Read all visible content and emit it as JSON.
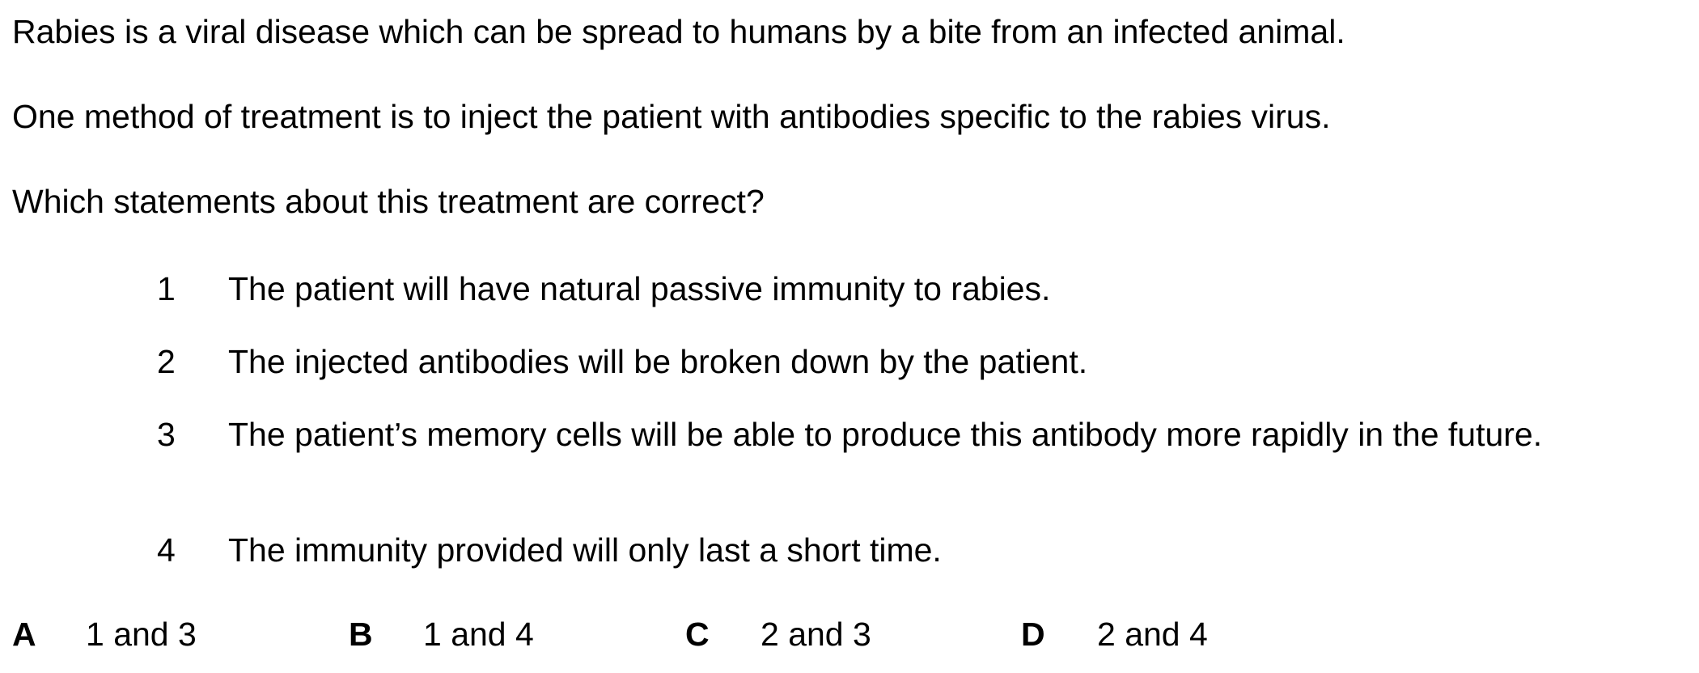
{
  "question": {
    "intro": "Rabies is a viral disease which can be spread to humans by a bite from an infected animal.",
    "treatment": "One method of treatment is to inject the patient with antibodies specific to the rabies virus.",
    "prompt": "Which statements about this treatment are correct?"
  },
  "statements": [
    {
      "number": "1",
      "text": "The patient will have natural passive immunity to rabies."
    },
    {
      "number": "2",
      "text": "The injected antibodies will be broken down by the patient."
    },
    {
      "number": "3",
      "text": "The patient’s memory cells will be able to produce this antibody more rapidly in the future."
    },
    {
      "number": "4",
      "text": "The immunity provided will only last a short time."
    }
  ],
  "options": [
    {
      "letter": "A",
      "text": "1 and 3"
    },
    {
      "letter": "B",
      "text": "1 and 4"
    },
    {
      "letter": "C",
      "text": "2 and 3"
    },
    {
      "letter": "D",
      "text": "2 and 4"
    }
  ]
}
